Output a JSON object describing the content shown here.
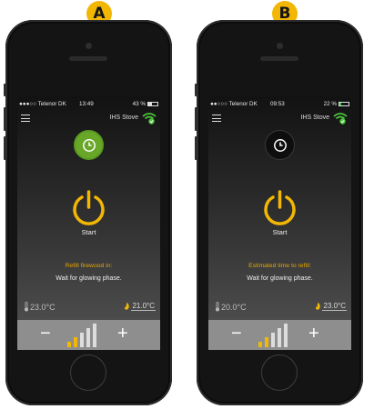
{
  "phones": [
    {
      "label": "A",
      "carrier": "●●●○○ Telenor DK",
      "time": "13:49",
      "battery": "43 %",
      "battery_level": 0.43,
      "stove_name": "IHS Stove",
      "timer_state": "active-green",
      "start_label": "Start",
      "refill_label": "Refill firewood in:",
      "wait_text": "Wait for glowing phase.",
      "temp_left": "23.0°C",
      "temp_right": "21.0°C",
      "level": 2,
      "level_max": 5
    },
    {
      "label": "B",
      "carrier": "●●○○○ Telenor DK",
      "time": "09:53",
      "battery": "22 %",
      "battery_level": 0.22,
      "stove_name": "IHS Stove",
      "timer_state": "inactive-dark",
      "start_label": "Start",
      "refill_label": "Estimated time to refill:",
      "wait_text": "Wait for glowing phase.",
      "temp_left": "20.0°C",
      "temp_right": "23.0°C",
      "level": 2,
      "level_max": 5
    }
  ],
  "controls": {
    "minus": "−",
    "plus": "+"
  },
  "icons": {
    "menu": "hamburger-icon",
    "wifi": "wifi-check-icon",
    "clock": "clock-icon",
    "power": "power-icon",
    "thermometer": "thermometer-icon",
    "flame": "flame-icon"
  },
  "colors": {
    "accent": "#f2b705",
    "green": "#69a729",
    "control_bg": "#8e8e8e"
  }
}
